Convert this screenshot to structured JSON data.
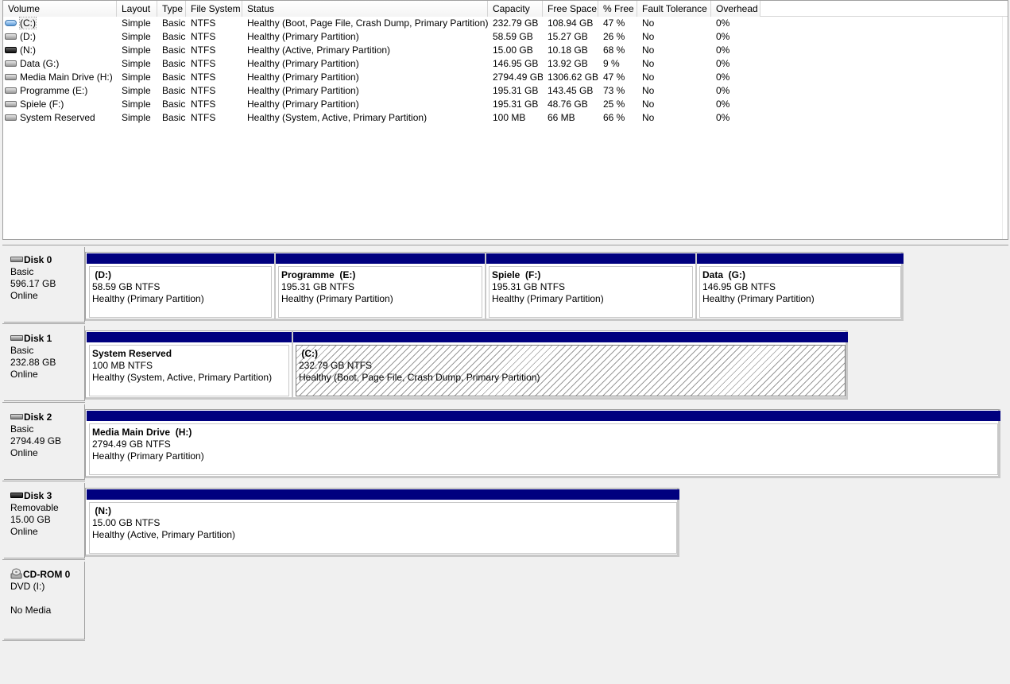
{
  "volume_list": {
    "columns": [
      "Volume",
      "Layout",
      "Type",
      "File System",
      "Status",
      "Capacity",
      "Free Space",
      "% Free",
      "Fault Tolerance",
      "Overhead"
    ],
    "rows": [
      {
        "volume": "(C:)",
        "layout": "Simple",
        "type": "Basic",
        "fs": "NTFS",
        "status": "Healthy (Boot, Page File, Crash Dump, Primary Partition)",
        "capacity": "232.79 GB",
        "free": "108.94 GB",
        "pct": "47 %",
        "fault": "No",
        "overhead": "0%",
        "icon": "blue-drive-icon"
      },
      {
        "volume": "(D:)",
        "layout": "Simple",
        "type": "Basic",
        "fs": "NTFS",
        "status": "Healthy (Primary Partition)",
        "capacity": "58.59 GB",
        "free": "15.27 GB",
        "pct": "26 %",
        "fault": "No",
        "overhead": "0%",
        "icon": "drive-icon"
      },
      {
        "volume": "(N:)",
        "layout": "Simple",
        "type": "Basic",
        "fs": "NTFS",
        "status": "Healthy (Active, Primary Partition)",
        "capacity": "15.00 GB",
        "free": "10.18 GB",
        "pct": "68 %",
        "fault": "No",
        "overhead": "0%",
        "icon": "removable-drive-icon"
      },
      {
        "volume": "Data (G:)",
        "layout": "Simple",
        "type": "Basic",
        "fs": "NTFS",
        "status": "Healthy (Primary Partition)",
        "capacity": "146.95 GB",
        "free": "13.92 GB",
        "pct": "9 %",
        "fault": "No",
        "overhead": "0%",
        "icon": "drive-icon"
      },
      {
        "volume": "Media Main Drive (H:)",
        "layout": "Simple",
        "type": "Basic",
        "fs": "NTFS",
        "status": "Healthy (Primary Partition)",
        "capacity": "2794.49 GB",
        "free": "1306.62 GB",
        "pct": "47 %",
        "fault": "No",
        "overhead": "0%",
        "icon": "drive-icon"
      },
      {
        "volume": "Programme (E:)",
        "layout": "Simple",
        "type": "Basic",
        "fs": "NTFS",
        "status": "Healthy (Primary Partition)",
        "capacity": "195.31 GB",
        "free": "143.45 GB",
        "pct": "73 %",
        "fault": "No",
        "overhead": "0%",
        "icon": "drive-icon"
      },
      {
        "volume": "Spiele (F:)",
        "layout": "Simple",
        "type": "Basic",
        "fs": "NTFS",
        "status": "Healthy (Primary Partition)",
        "capacity": "195.31 GB",
        "free": "48.76 GB",
        "pct": "25 %",
        "fault": "No",
        "overhead": "0%",
        "icon": "drive-icon"
      },
      {
        "volume": "System Reserved",
        "layout": "Simple",
        "type": "Basic",
        "fs": "NTFS",
        "status": "Healthy (System, Active, Primary Partition)",
        "capacity": "100 MB",
        "free": "66 MB",
        "pct": "66 %",
        "fault": "No",
        "overhead": "0%",
        "icon": "drive-icon"
      }
    ]
  },
  "disks": [
    {
      "name": "Disk 0",
      "kind": "Basic",
      "size": "596.17 GB",
      "state": "Online",
      "icon": "disk-icon",
      "partitions": [
        {
          "name": " (D:)",
          "size": "58.59 GB NTFS",
          "status": "Healthy (Primary Partition)",
          "hatched": false
        },
        {
          "name": "Programme  (E:)",
          "size": "195.31 GB NTFS",
          "status": "Healthy (Primary Partition)",
          "hatched": false
        },
        {
          "name": "Spiele  (F:)",
          "size": "195.31 GB NTFS",
          "status": "Healthy (Primary Partition)",
          "hatched": false
        },
        {
          "name": "Data  (G:)",
          "size": "146.95 GB NTFS",
          "status": "Healthy (Primary Partition)",
          "hatched": false
        }
      ]
    },
    {
      "name": "Disk 1",
      "kind": "Basic",
      "size": "232.88 GB",
      "state": "Online",
      "icon": "disk-icon",
      "partitions": [
        {
          "name": "System Reserved",
          "size": "100 MB NTFS",
          "status": "Healthy (System, Active, Primary Partition)",
          "hatched": false
        },
        {
          "name": " (C:)",
          "size": "232.79 GB NTFS",
          "status": "Healthy (Boot, Page File, Crash Dump, Primary Partition)",
          "hatched": true
        }
      ]
    },
    {
      "name": "Disk 2",
      "kind": "Basic",
      "size": "2794.49 GB",
      "state": "Online",
      "icon": "disk-icon",
      "partitions": [
        {
          "name": "Media Main Drive  (H:)",
          "size": "2794.49 GB NTFS",
          "status": "Healthy (Primary Partition)",
          "hatched": false
        }
      ]
    },
    {
      "name": "Disk 3",
      "kind": "Removable",
      "size": "15.00 GB",
      "state": "Online",
      "icon": "removable-disk-icon",
      "partitions": [
        {
          "name": " (N:)",
          "size": "15.00 GB NTFS",
          "status": "Healthy (Active, Primary Partition)",
          "hatched": false
        }
      ]
    },
    {
      "name": "CD-ROM 0",
      "kind": "DVD (I:)",
      "size": "",
      "state": "No Media",
      "icon": "cdrom-icon",
      "partitions": []
    }
  ],
  "colors": {
    "partition_bar": "#00007f",
    "selection_outline": "#a8a8a8"
  }
}
